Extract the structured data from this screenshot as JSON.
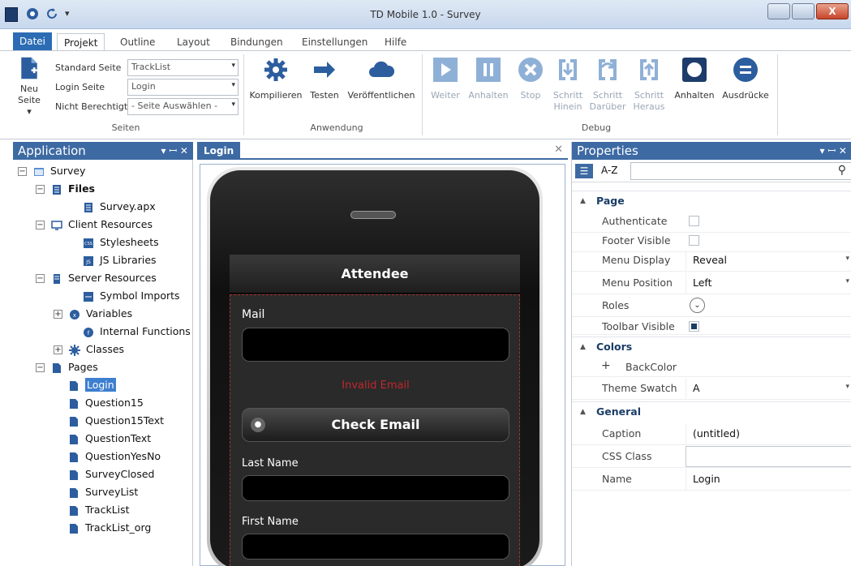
{
  "window": {
    "title": "TD Mobile 1.0 - Survey",
    "close_label": "X"
  },
  "menu": {
    "file_label": "Datei",
    "tabs": [
      "Projekt",
      "Outline",
      "Layout",
      "Bindungen",
      "Einstellungen",
      "Hilfe"
    ],
    "active_tab": "Projekt"
  },
  "ribbon": {
    "pages": {
      "new_label_1": "Neu",
      "new_label_2": "Seite ▾",
      "standard_label": "Standard Seite",
      "standard_value": "TrackList",
      "login_label": "Login Seite",
      "login_value": "Login",
      "unauth_label": "Nicht Berechtigt",
      "unauth_value": "- Seite Auswählen -",
      "group_label": "Seiten"
    },
    "app": {
      "compile": "Kompilieren",
      "test": "Testen",
      "publish": "Veröffentlichen",
      "group_label": "Anwendung"
    },
    "debug": {
      "continue": "Weiter",
      "pause": "Anhalten",
      "stop": "Stop",
      "step_in_1": "Schritt",
      "step_in_2": "Hinein",
      "step_over_1": "Schritt",
      "step_over_2": "Darüber",
      "step_out_1": "Schritt",
      "step_out_2": "Heraus",
      "break": "Anhalten",
      "expressions": "Ausdrücke",
      "group_label": "Debug"
    }
  },
  "app_panel": {
    "title": "Application",
    "controls": "▾ ꟷ ✕",
    "tree": {
      "survey": "Survey",
      "files": "Files",
      "survey_apx": "Survey.apx",
      "client_resources": "Client Resources",
      "stylesheets": "Stylesheets",
      "js_libraries": "JS Libraries",
      "server_resources": "Server Resources",
      "symbol_imports": "Symbol Imports",
      "variables": "Variables",
      "internal_functions": "Internal Functions",
      "classes": "Classes",
      "pages": "Pages",
      "page_items": [
        "Login",
        "Question15",
        "Question15Text",
        "QuestionText",
        "QuestionYesNo",
        "SurveyClosed",
        "SurveyList",
        "TrackList",
        "TrackList_org"
      ]
    }
  },
  "designer": {
    "tab_label": "Login",
    "close": "✕",
    "screen": {
      "header": "Attendee",
      "mail_label": "Mail",
      "invalid": "Invalid Email",
      "check_button": "Check Email",
      "last_name_label": "Last Name",
      "first_name_label": "First Name"
    }
  },
  "props": {
    "title": "Properties",
    "controls": "▾ ꟷ ✕",
    "az": "A-Z",
    "categories": {
      "page": "Page",
      "colors": "Colors",
      "general": "General"
    },
    "page": {
      "authenticate": "Authenticate",
      "footer_visible": "Footer Visible",
      "menu_display": "Menu Display",
      "menu_display_value": "Reveal",
      "menu_position": "Menu Position",
      "menu_position_value": "Left",
      "roles": "Roles",
      "toolbar_visible": "Toolbar Visible"
    },
    "colors": {
      "backcolor": "BackColor",
      "theme_swatch": "Theme Swatch",
      "theme_swatch_value": "A"
    },
    "general": {
      "caption": "Caption",
      "caption_value": "(untitled)",
      "css_class": "CSS Class",
      "name": "Name",
      "name_value": "Login"
    }
  },
  "colors": {
    "accent": "#3d6aa3",
    "file_tab": "#2b6cb4",
    "error": "#c0272d",
    "selection": "#3e7fd0"
  }
}
